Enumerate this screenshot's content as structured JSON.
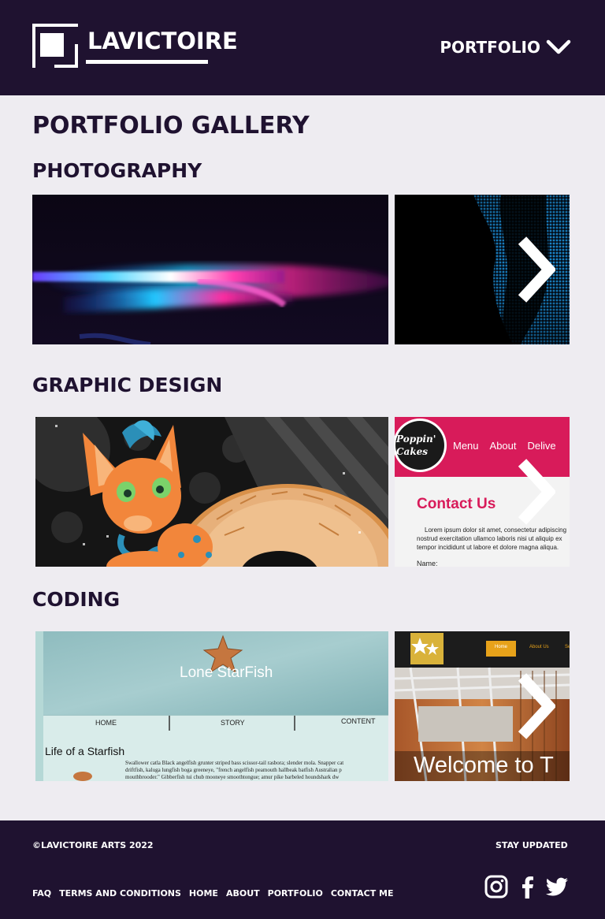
{
  "header": {
    "brand": "LAVICTOIRE",
    "nav_label": "PORTFOLIO"
  },
  "main": {
    "page_title": "PORTFOLIO GALLERY",
    "sections": [
      {
        "title": "PHOTOGRAPHY"
      },
      {
        "title": "GRAPHIC DESIGN",
        "tiles": [
          {
            "brand": "Poppin' Cakes",
            "nav": [
              "Menu",
              "About",
              "Delive"
            ],
            "heading": "Contact Us",
            "body1": "Lorem ipsum dolor sit amet, consectetur adipiscing",
            "body2": "nostrud exercitation ullamco laboris nisi ut aliquip ex",
            "body3": "tempor incididunt ut labore et dolore magna aliqua.",
            "field": "Name:"
          }
        ]
      },
      {
        "title": "CODING",
        "tiles": [
          {
            "site_title": "Lone StarFish",
            "nav": [
              "HOME",
              "STORY",
              "CONTENT"
            ],
            "heading": "Life of a Starfish",
            "body1": "Swallower catla Black angelfish grunter striped bass scissor-tail rasbora; slender mola. Snapper cat",
            "body2": "driftfish, kaluga lungfish boga greeneye, \"french angelfish peamouth hallbeak batfish Australian p",
            "body3": "mouthbrooder.\" Gibberfish tui chub mooneye smoothtongue; amur pike barbeled houndshark dw"
          },
          {
            "nav": [
              "Home",
              "About Us",
              "Se"
            ],
            "welcome": "Welcome to T"
          }
        ]
      }
    ]
  },
  "footer": {
    "copyright": "©LAVICTOIRE ARTS 2022",
    "stay_updated": "STAY UPDATED",
    "links": [
      "FAQ",
      "TERMS AND CONDITIONS",
      "HOME",
      "ABOUT",
      "PORTFOLIO",
      "CONTACT ME"
    ],
    "social": [
      "instagram-icon",
      "facebook-icon",
      "twitter-icon"
    ]
  },
  "colors": {
    "header_bg": "#1f1230",
    "page_bg": "#eeecf1",
    "accent_pink": "#d81b5a"
  }
}
